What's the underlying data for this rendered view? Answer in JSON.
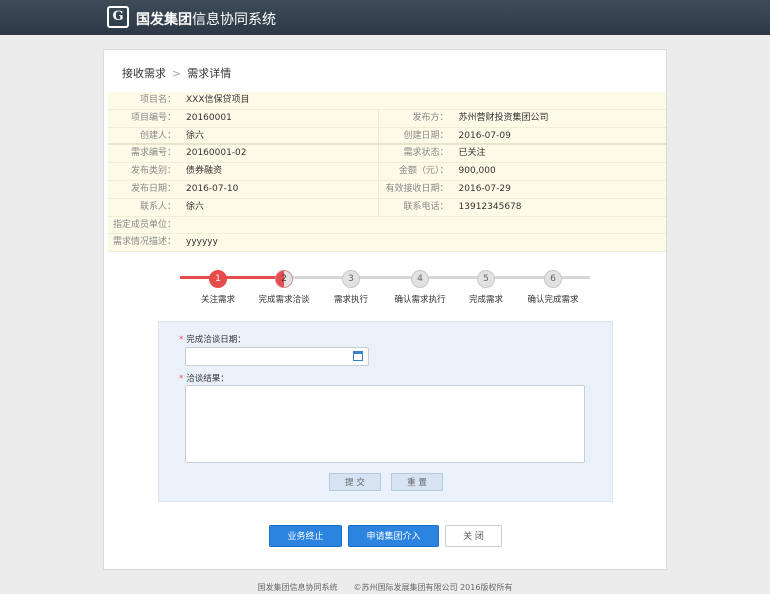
{
  "app": {
    "logo": "G",
    "title_bold": "国发集团",
    "title_rest": "信息协同系统"
  },
  "breadcrumb": {
    "parent": "接收需求",
    "separator": ">",
    "current": "需求详情"
  },
  "info_rows": [
    {
      "l1": "项目名：",
      "v1": "XXX信保贷项目",
      "l2": "",
      "v2": ""
    },
    {
      "l1": "项目编号：",
      "v1": "20160001",
      "l2": "发布方：",
      "v2": "苏州营财投资集团公司"
    },
    {
      "l1": "创建人：",
      "v1": "徐六",
      "l2": "创建日期：",
      "v2": "2016-07-09"
    },
    {
      "l1": "需求编号：",
      "v1": "20160001-02",
      "l2": "需求状态：",
      "v2": "已关注"
    },
    {
      "l1": "发布类别：",
      "v1": "债券融资",
      "l2": "金额（元）：",
      "v2": "900,000"
    },
    {
      "l1": "发布日期：",
      "v1": "2016-07-10",
      "l2": "有效接收日期：",
      "v2": "2016-07-29"
    },
    {
      "l1": "联系人：",
      "v1": "徐六",
      "l2": "联系电话：",
      "v2": "13912345678"
    },
    {
      "l1": "指定成员单位：",
      "v1": "",
      "l2": "",
      "v2": ""
    },
    {
      "l1": "需求情况描述：",
      "v1": "yyyyyy",
      "l2": "",
      "v2": ""
    }
  ],
  "steps": [
    {
      "num": "1",
      "label": "关注需求",
      "state": "done"
    },
    {
      "num": "2",
      "label": "完成需求洽谈",
      "state": "half"
    },
    {
      "num": "3",
      "label": "需求执行",
      "state": "todo"
    },
    {
      "num": "4",
      "label": "确认需求执行",
      "state": "todo"
    },
    {
      "num": "5",
      "label": "完成需求",
      "state": "todo"
    },
    {
      "num": "6",
      "label": "确认完成需求",
      "state": "todo"
    }
  ],
  "form": {
    "required_mark": "*",
    "date_label": "完成洽谈日期：",
    "date_value": "",
    "result_label": "洽谈结果：",
    "result_value": "",
    "submit": "提 交",
    "reset": "重 置"
  },
  "actions": {
    "terminate": "业务终止",
    "apply": "申请集团介入",
    "close": "关 闭"
  },
  "footer": {
    "system": "国发集团信息协同系统",
    "copyright": "©苏州国际发展集团有限公司 2016版权所有"
  },
  "colors": {
    "accent": "#2b84e0",
    "progress": "#e74c4c",
    "header": "#34414e"
  },
  "icons": {
    "date": "calendar-icon"
  }
}
